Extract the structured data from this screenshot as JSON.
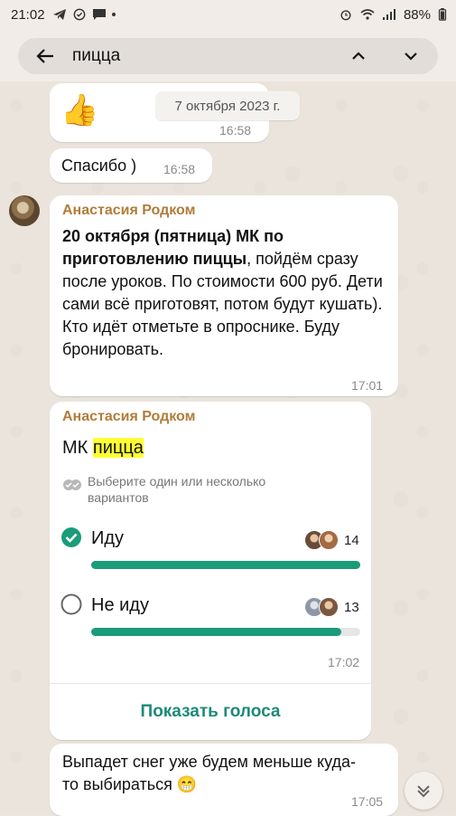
{
  "status_bar": {
    "time": "21:02",
    "battery": "88%"
  },
  "search": {
    "query": "пицца"
  },
  "date_chip": "7 октября 2023 г.",
  "messages": [
    {
      "type": "emoji",
      "emoji": "👍",
      "time": "16:58"
    },
    {
      "type": "text",
      "text": "Спасибо )",
      "time": "16:58"
    },
    {
      "type": "text",
      "sender": "Анастасия Родком",
      "bold_text": "20 октября (пятница) МК по приготовлению пиццы",
      "text": ", пойдём сразу после уроков. По стоимости 600 руб. Дети сами всё приготовят, потом будут кушать). Кто идёт отметьте  в опроснике. Буду бронировать.",
      "time": "17:01"
    },
    {
      "type": "poll",
      "sender": "Анастасия Родком",
      "title_prefix": "МК ",
      "title_highlight": "пицца",
      "hint": "Выберите один или несколько вариантов",
      "options": [
        {
          "label": "Иду",
          "count": "14",
          "checked": true,
          "fraction": 1.0
        },
        {
          "label": "Не иду",
          "count": "13",
          "checked": false,
          "fraction": 0.93
        }
      ],
      "time": "17:02",
      "show_votes": "Показать голоса"
    },
    {
      "type": "text",
      "text": "Выпадет снег уже будем меньше куда-то выбираться 😁",
      "time": "17:05"
    }
  ],
  "colors": {
    "accent": "#1a9c7a",
    "sender": "#b07d3a",
    "highlight": "#ffff33"
  }
}
